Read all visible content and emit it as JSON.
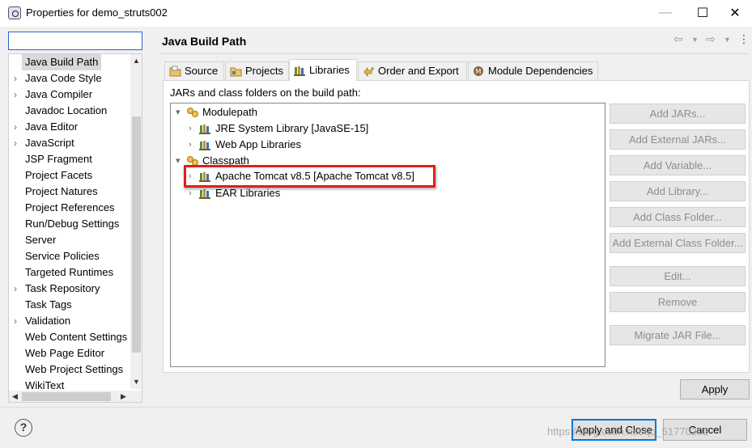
{
  "window": {
    "title": "Properties for demo_struts002",
    "controls": {
      "minimize": "—",
      "maximize": "☐",
      "close": "✕"
    }
  },
  "sidebar": {
    "filter_value": "",
    "items": [
      {
        "label": "Java Build Path",
        "expandable": false,
        "selected": true
      },
      {
        "label": "Java Code Style",
        "expandable": true
      },
      {
        "label": "Java Compiler",
        "expandable": true
      },
      {
        "label": "Javadoc Location",
        "expandable": false
      },
      {
        "label": "Java Editor",
        "expandable": true
      },
      {
        "label": "JavaScript",
        "expandable": true
      },
      {
        "label": "JSP Fragment",
        "expandable": false
      },
      {
        "label": "Project Facets",
        "expandable": false
      },
      {
        "label": "Project Natures",
        "expandable": false
      },
      {
        "label": "Project References",
        "expandable": false
      },
      {
        "label": "Run/Debug Settings",
        "expandable": false
      },
      {
        "label": "Server",
        "expandable": false
      },
      {
        "label": "Service Policies",
        "expandable": false
      },
      {
        "label": "Targeted Runtimes",
        "expandable": false
      },
      {
        "label": "Task Repository",
        "expandable": true
      },
      {
        "label": "Task Tags",
        "expandable": false
      },
      {
        "label": "Validation",
        "expandable": true
      },
      {
        "label": "Web Content Settings",
        "expandable": false
      },
      {
        "label": "Web Page Editor",
        "expandable": false
      },
      {
        "label": "Web Project Settings",
        "expandable": false
      },
      {
        "label": "WikiText",
        "expandable": false
      }
    ]
  },
  "main": {
    "title": "Java Build Path",
    "tabs": [
      {
        "label": "Source",
        "icon": "source-folder-icon"
      },
      {
        "label": "Projects",
        "icon": "projects-icon"
      },
      {
        "label": "Libraries",
        "icon": "libraries-icon",
        "active": true
      },
      {
        "label": "Order and Export",
        "icon": "order-export-icon"
      },
      {
        "label": "Module Dependencies",
        "icon": "module-dependencies-icon"
      }
    ],
    "description": "JARs and class folders on the build path:",
    "tree": [
      {
        "label": "Modulepath",
        "level": 0,
        "expanded": true,
        "icon": "path-icon"
      },
      {
        "label": "JRE System Library [JavaSE-15]",
        "level": 1,
        "expanded": false,
        "icon": "library-icon"
      },
      {
        "label": "Web App Libraries",
        "level": 1,
        "expanded": false,
        "icon": "library-icon"
      },
      {
        "label": "Classpath",
        "level": 0,
        "expanded": true,
        "icon": "path-icon"
      },
      {
        "label": "Apache Tomcat v8.5 [Apache Tomcat v8.5]",
        "level": 1,
        "expanded": false,
        "icon": "library-icon",
        "highlighted": true
      },
      {
        "label": "EAR Libraries",
        "level": 1,
        "expanded": false,
        "icon": "library-icon"
      }
    ],
    "buttons": {
      "add_jars": "Add JARs...",
      "add_external_jars": "Add External JARs...",
      "add_variable": "Add Variable...",
      "add_library": "Add Library...",
      "add_class_folder": "Add Class Folder...",
      "add_external_class_folder": "Add External Class Folder...",
      "edit": "Edit...",
      "remove": "Remove",
      "migrate_jar": "Migrate JAR File..."
    },
    "apply": "Apply"
  },
  "footer": {
    "help": "?",
    "apply_and_close": "Apply and Close",
    "cancel": "Cancel",
    "watermark": "https://blog.csdn.net/qq_51770202"
  },
  "colors": {
    "highlight_border": "#e0201b",
    "primary_border": "#0078d7",
    "disabled_text": "#8d8d8d"
  }
}
